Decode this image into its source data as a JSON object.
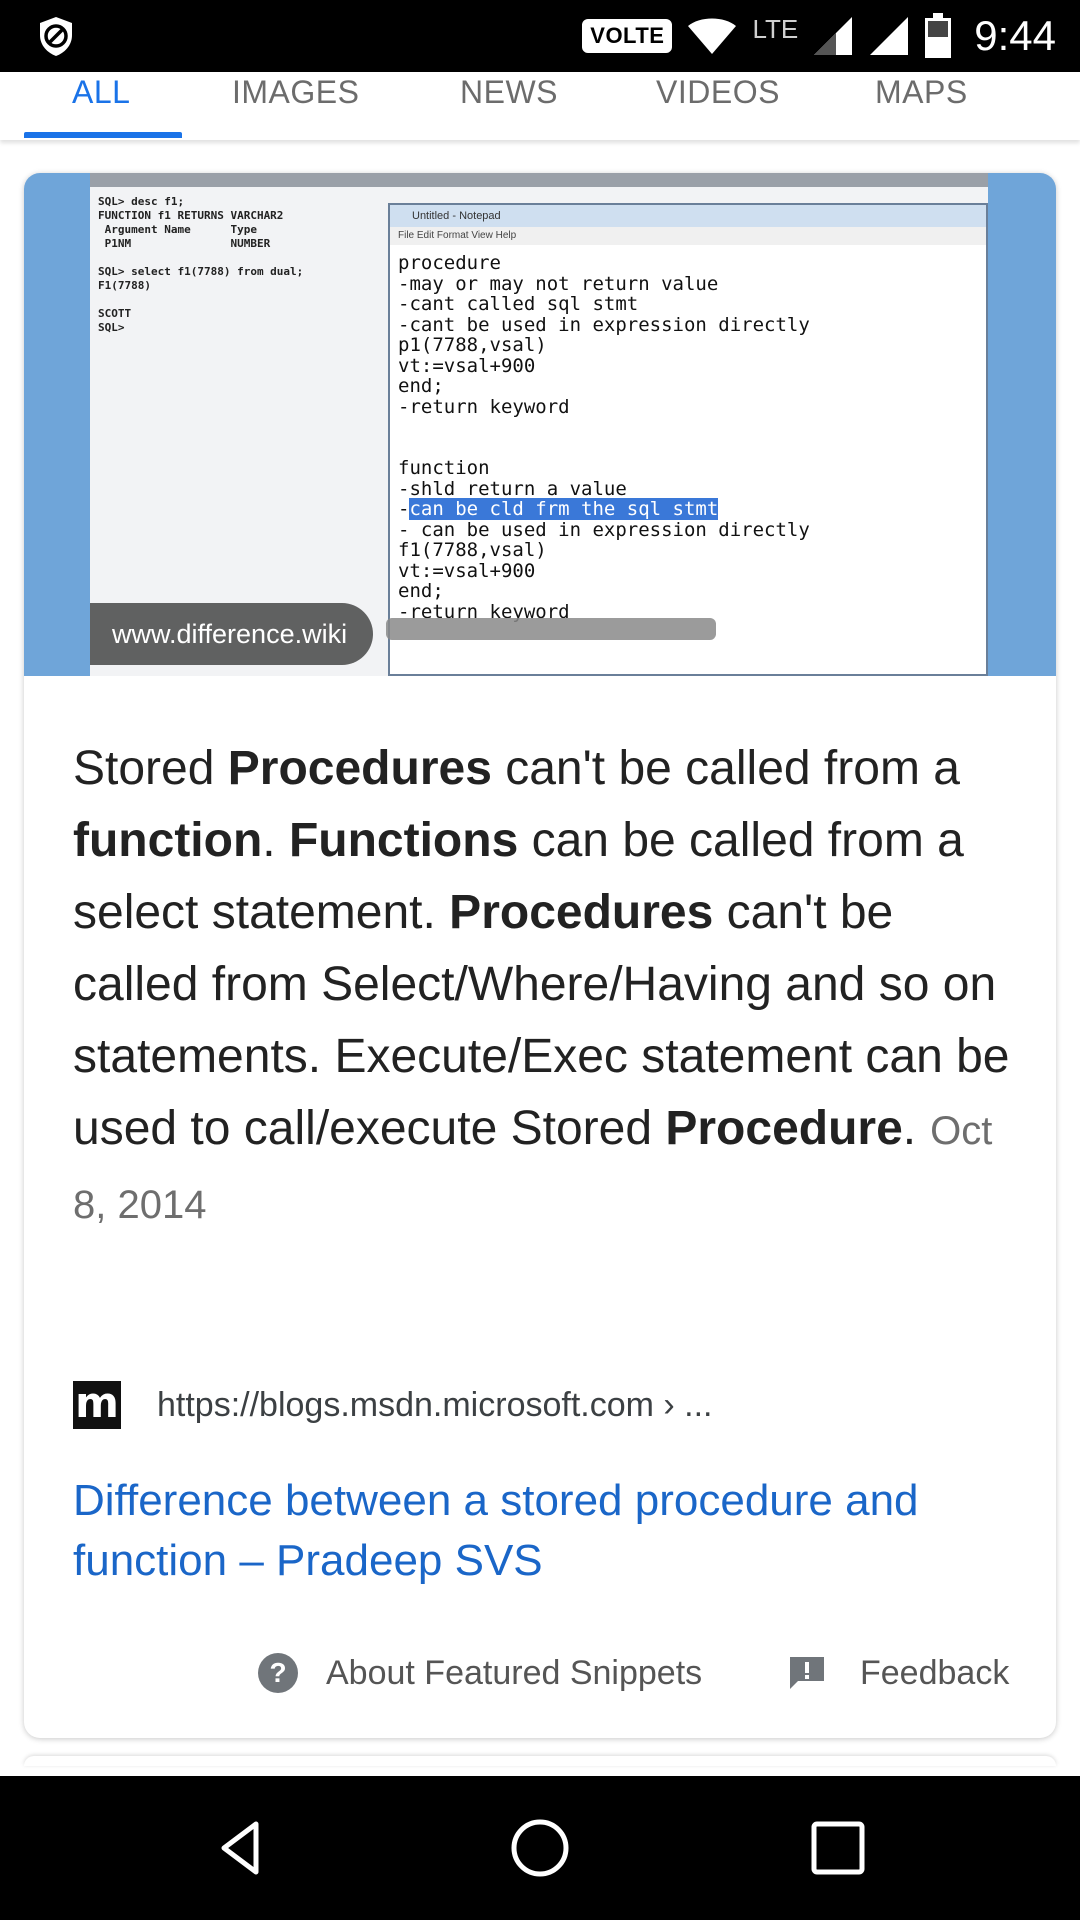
{
  "status_bar": {
    "volte_label": "VOLTE",
    "network_label": "LTE",
    "time": "9:44",
    "icons": [
      "adblock-shield-icon",
      "wifi-icon",
      "signal-icon",
      "signal-icon",
      "battery-icon"
    ]
  },
  "tabs": [
    {
      "label": "ALL",
      "active": true
    },
    {
      "label": "IMAGES",
      "active": false
    },
    {
      "label": "NEWS",
      "active": false
    },
    {
      "label": "VIDEOS",
      "active": false
    },
    {
      "label": "MAPS",
      "active": false
    }
  ],
  "featured": {
    "image_source": "www.difference.wiki",
    "snippet_date": "Oct 8, 2014",
    "source_url": "https://blogs.msdn.microsoft.com › ...",
    "favicon_letter": "m",
    "result_title": "Difference between a stored procedure and function – Pradeep SVS",
    "about_label": "About Featured Snippets",
    "feedback_label": "Feedback"
  },
  "colors": {
    "accent": "#1a73e8",
    "link": "#1a66c8",
    "hero_background": "#6fa5d9"
  }
}
